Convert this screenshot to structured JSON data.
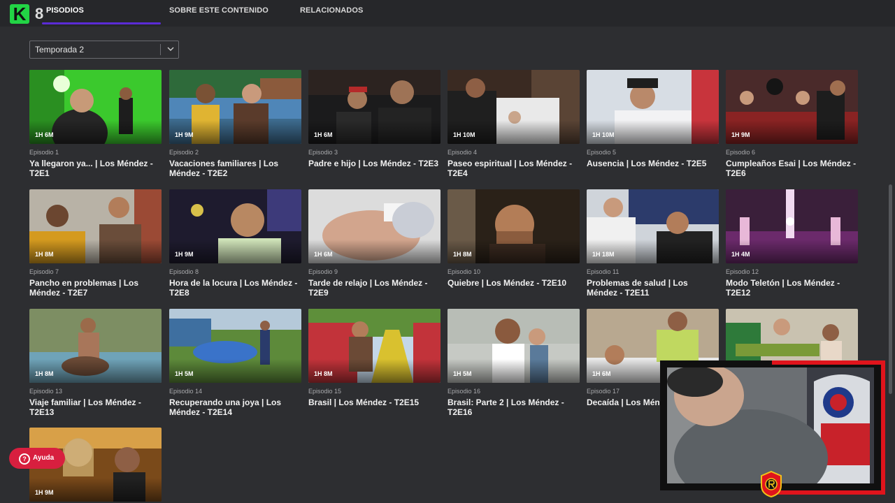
{
  "header": {
    "logo_letter": "K",
    "logo_number": "8",
    "tabs": [
      {
        "label": "EPISODIOS",
        "active": true,
        "visible_text": "PISODIOS"
      },
      {
        "label": "SOBRE ESTE CONTENIDO",
        "active": false
      },
      {
        "label": "RELACIONADOS",
        "active": false
      }
    ],
    "accent_color": "#5b2bd6"
  },
  "season_select": {
    "value": "Temporada 2"
  },
  "episodes": [
    {
      "number": "Episodio 1",
      "title": "Ya llegaron ya... | Los Méndez - T2E1",
      "duration": "1H 6M"
    },
    {
      "number": "Episodio 2",
      "title": "Vacaciones familiares | Los Méndez - T2E2",
      "duration": "1H 9M"
    },
    {
      "number": "Episodio 3",
      "title": "Padre e hijo | Los Méndez - T2E3",
      "duration": "1H 6M"
    },
    {
      "number": "Episodio 4",
      "title": "Paseo espiritual | Los Méndez - T2E4",
      "duration": "1H 10M"
    },
    {
      "number": "Episodio 5",
      "title": "Ausencia | Los Méndez - T2E5",
      "duration": "1H 10M"
    },
    {
      "number": "Episodio 6",
      "title": "Cumpleaños Esai | Los Méndez - T2E6",
      "duration": "1H 9M"
    },
    {
      "number": "Episodio 7",
      "title": "Pancho en problemas | Los Méndez - T2E7",
      "duration": "1H 8M"
    },
    {
      "number": "Episodio 8",
      "title": "Hora de la locura | Los Méndez - T2E8",
      "duration": "1H 9M"
    },
    {
      "number": "Episodio 9",
      "title": "Tarde de relajo | Los Méndez - T2E9",
      "duration": "1H 6M"
    },
    {
      "number": "Episodio 10",
      "title": "Quiebre | Los Méndez - T2E10",
      "duration": "1H 8M"
    },
    {
      "number": "Episodio 11",
      "title": "Problemas de salud | Los Méndez - T2E11",
      "duration": "1H 18M"
    },
    {
      "number": "Episodio 12",
      "title": "Modo Teletón | Los Méndez - T2E12",
      "duration": "1H 4M"
    },
    {
      "number": "Episodio 13",
      "title": "Viaje familiar | Los Méndez - T2E13",
      "duration": "1H 8M"
    },
    {
      "number": "Episodio 14",
      "title": "Recuperando una joya | Los Méndez - T2E14",
      "duration": "1H 5M"
    },
    {
      "number": "Episodio 15",
      "title": "Brasil | Los Méndez - T2E15",
      "duration": "1H 8M"
    },
    {
      "number": "Episodio 16",
      "title": "Brasil: Parte 2 | Los Méndez - T2E16",
      "duration": "1H 5M"
    },
    {
      "number": "Episodio 17",
      "title": "Decaída | Los Ménd",
      "duration": "1H 6M"
    },
    {
      "number": "",
      "title": "",
      "duration": ""
    },
    {
      "number": "",
      "title": "",
      "duration": "1H 9M"
    }
  ],
  "help_button": {
    "label": "Ayuda",
    "color": "#d81f3f"
  }
}
